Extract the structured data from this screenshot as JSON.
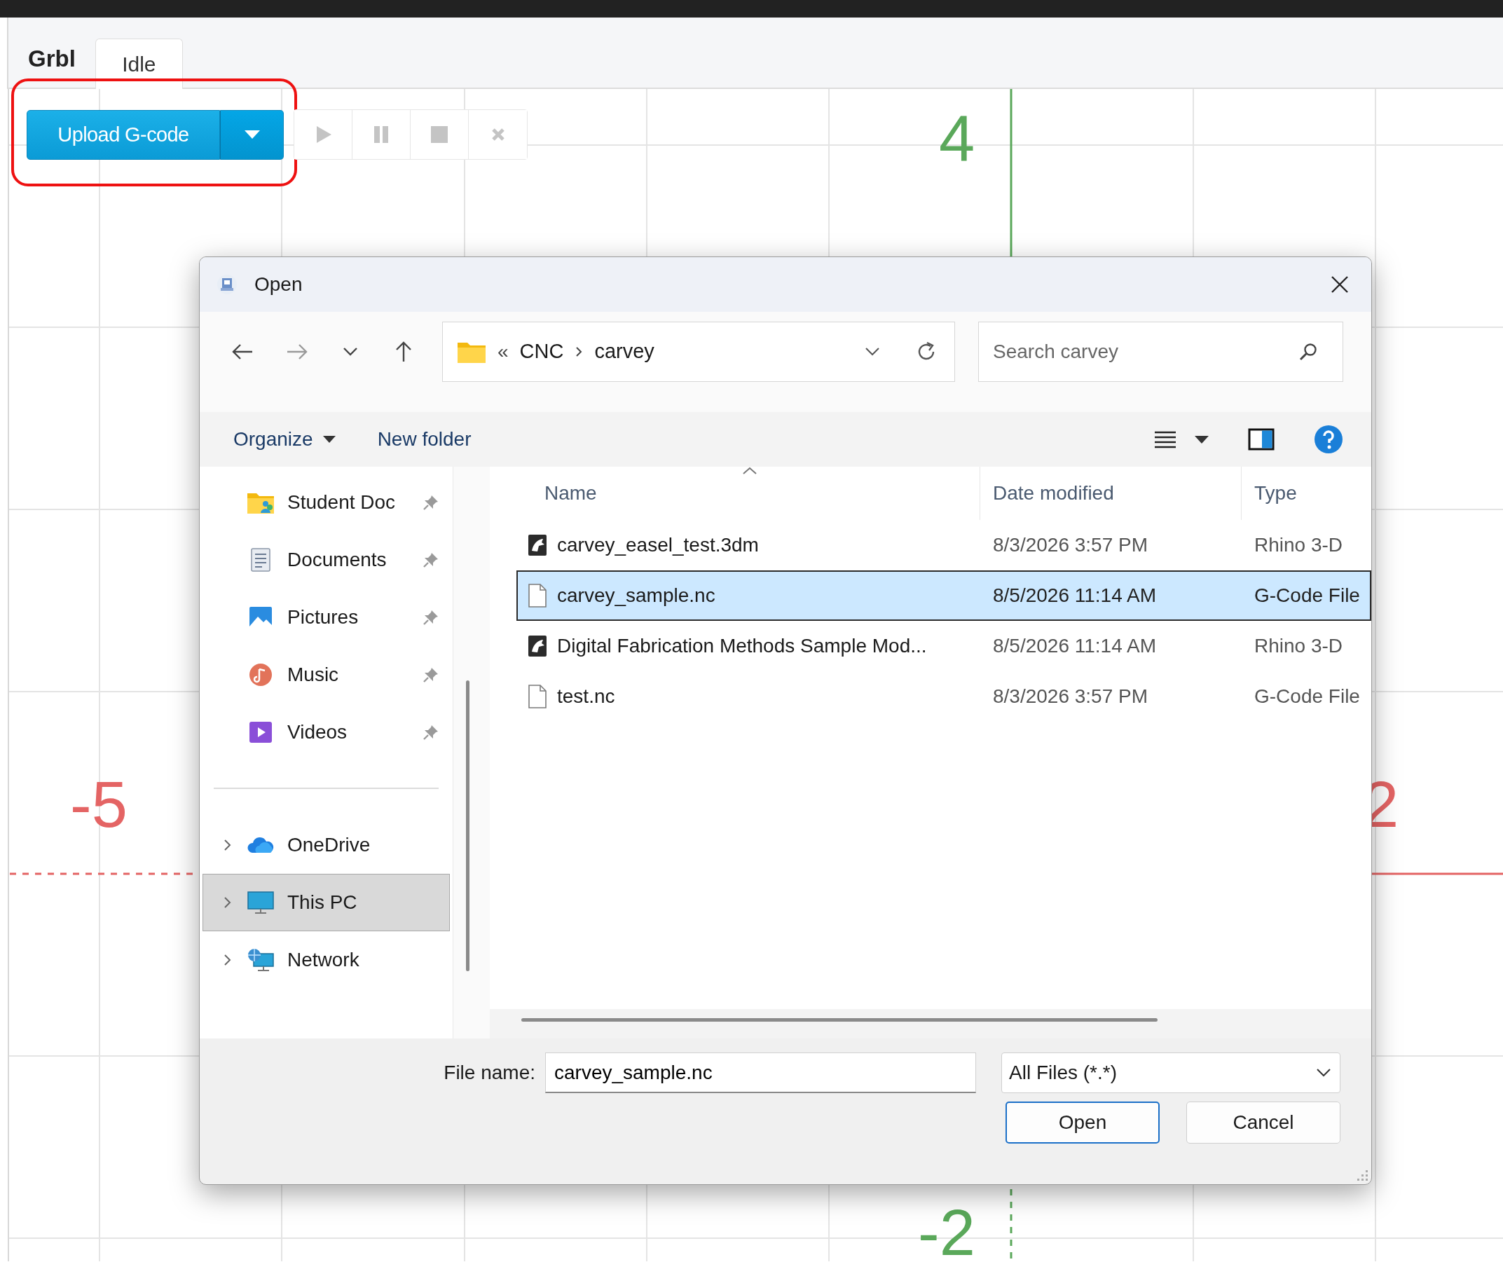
{
  "app": {
    "brand": "Grbl",
    "status_tab": {
      "label": "Idle",
      "selected": true
    }
  },
  "toolbar": {
    "upload_button": "Upload G-code",
    "buttons": [
      {
        "kind": "play",
        "disabled": true
      },
      {
        "kind": "pause",
        "disabled": true
      },
      {
        "kind": "stop",
        "disabled": true
      },
      {
        "kind": "close",
        "disabled": true
      }
    ]
  },
  "canvas": {
    "axis_labels": [
      {
        "text": "4",
        "color": "#5aa85a"
      },
      {
        "text": "-5",
        "color": "#e46464"
      },
      {
        "text": "2",
        "color": "#e46464"
      },
      {
        "text": "-2",
        "color": "#5aa85a"
      }
    ]
  },
  "dialog": {
    "title": "Open",
    "path_overflow": "«",
    "breadcrumb": [
      "CNC",
      "carvey"
    ],
    "search": {
      "placeholder": "Search carvey"
    },
    "commands": [
      "Organize",
      "New folder"
    ],
    "sidebar": {
      "quick_access": [
        {
          "label": "Student Doc",
          "kind": "student",
          "pinned": true,
          "selected": false
        },
        {
          "label": "Documents",
          "kind": "documents",
          "pinned": true,
          "selected": false
        },
        {
          "label": "Pictures",
          "kind": "pictures",
          "pinned": true,
          "selected": false
        },
        {
          "label": "Music",
          "kind": "music",
          "pinned": true,
          "selected": false
        },
        {
          "label": "Videos",
          "kind": "videos",
          "pinned": true,
          "selected": false
        }
      ],
      "locations": [
        {
          "label": "OneDrive",
          "kind": "onedrive",
          "expanded": false,
          "selected": false
        },
        {
          "label": "This PC",
          "kind": "pc",
          "expanded": false,
          "selected": true
        },
        {
          "label": "Network",
          "kind": "network",
          "expanded": false,
          "selected": false
        }
      ]
    },
    "columns": [
      {
        "label": "Name",
        "sorted": true
      },
      {
        "label": "Date modified",
        "sorted": false
      },
      {
        "label": "Type",
        "sorted": false
      }
    ],
    "files": [
      {
        "name": "carvey_easel_test.3dm",
        "kind": "rhino",
        "date": "8/3/2026 3:57 PM",
        "type": "Rhino 3-D",
        "selected": false
      },
      {
        "name": "carvey_sample.nc",
        "kind": "file",
        "date": "8/5/2026 11:14 AM",
        "type": "G-Code File",
        "selected": true
      },
      {
        "name": "Digital Fabrication Methods Sample Mod...",
        "kind": "rhino",
        "date": "8/5/2026 11:14 AM",
        "type": "Rhino 3-D",
        "selected": false
      },
      {
        "name": "test.nc",
        "kind": "file",
        "date": "8/3/2026 3:57 PM",
        "type": "G-Code File",
        "selected": false
      }
    ],
    "file_name": {
      "label": "File name:",
      "value": "carvey_sample.nc"
    },
    "file_type": "All Files (*.*)",
    "buttons": [
      {
        "label": "Open",
        "kind": "primary"
      },
      {
        "label": "Cancel",
        "kind": "secondary"
      }
    ]
  }
}
